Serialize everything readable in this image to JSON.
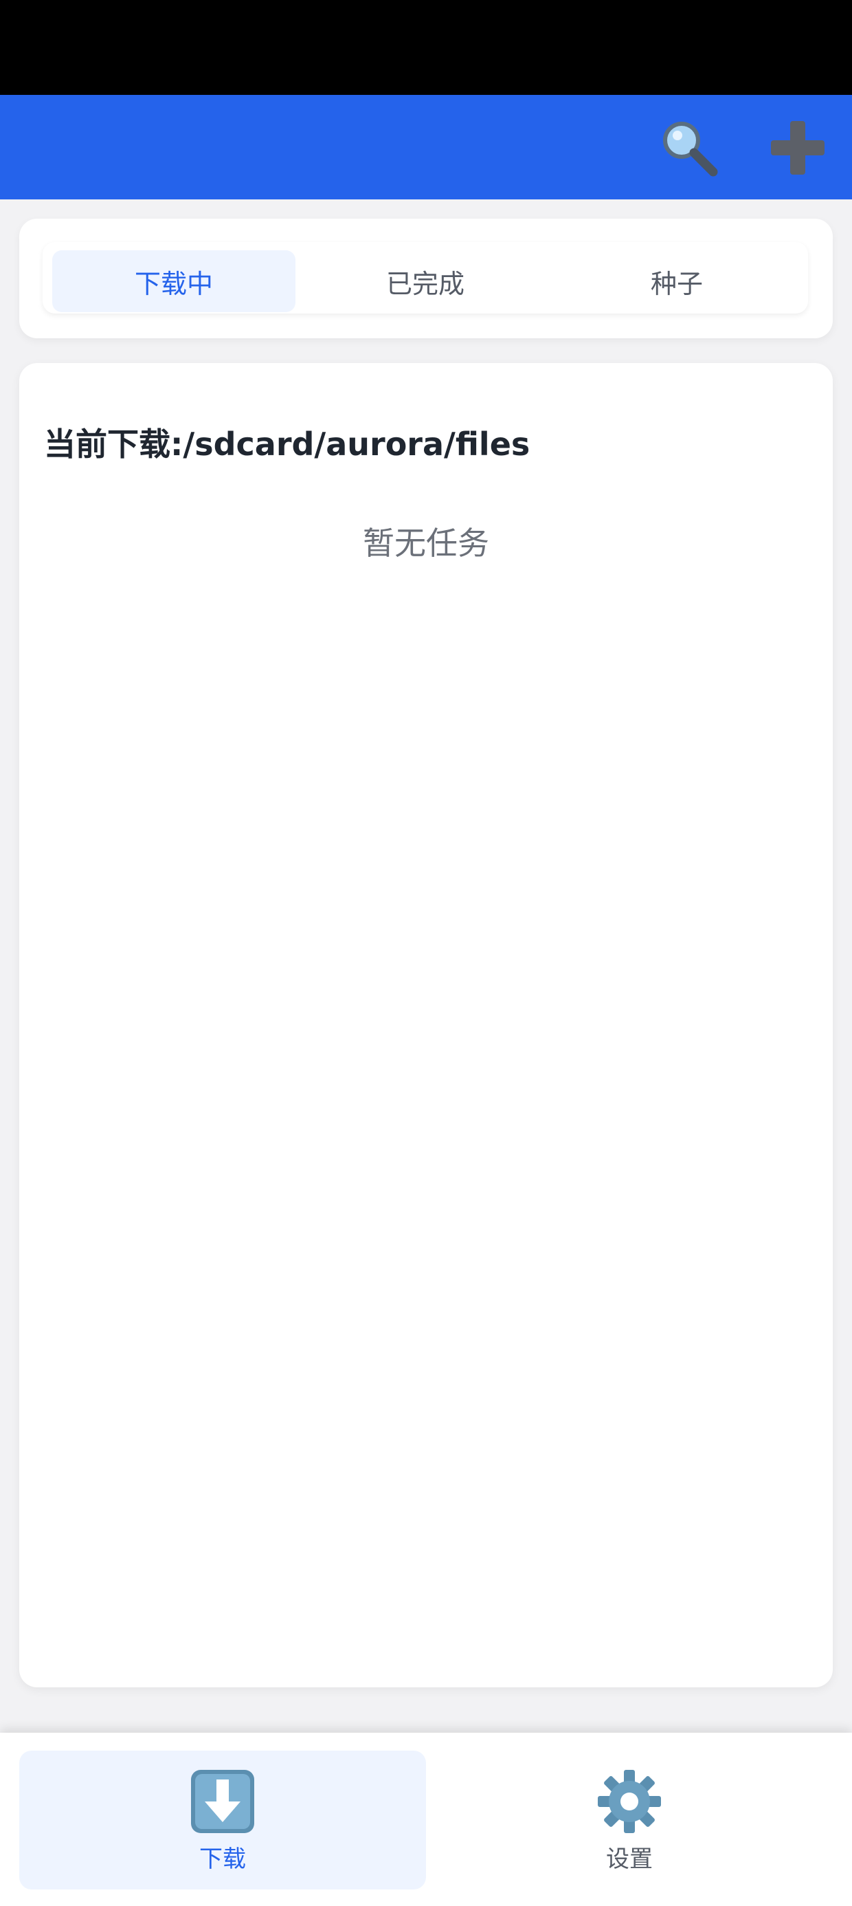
{
  "header": {
    "search_icon": "magnifier-icon",
    "add_icon": "plus-icon",
    "color": "#2563eb"
  },
  "tabs": [
    {
      "label": "下载中",
      "active": true
    },
    {
      "label": "已完成",
      "active": false
    },
    {
      "label": "种子",
      "active": false
    }
  ],
  "content": {
    "current_download": "当前下载:/sdcard/aurora/files",
    "empty_text": "暂无任务"
  },
  "bottom_nav": {
    "items": [
      {
        "label": "下载",
        "icon": "download-arrow-icon",
        "active": true
      },
      {
        "label": "设置",
        "icon": "gear-icon",
        "active": false
      }
    ]
  },
  "colors": {
    "accent": "#2563eb",
    "active_bg": "#eef4ff"
  }
}
